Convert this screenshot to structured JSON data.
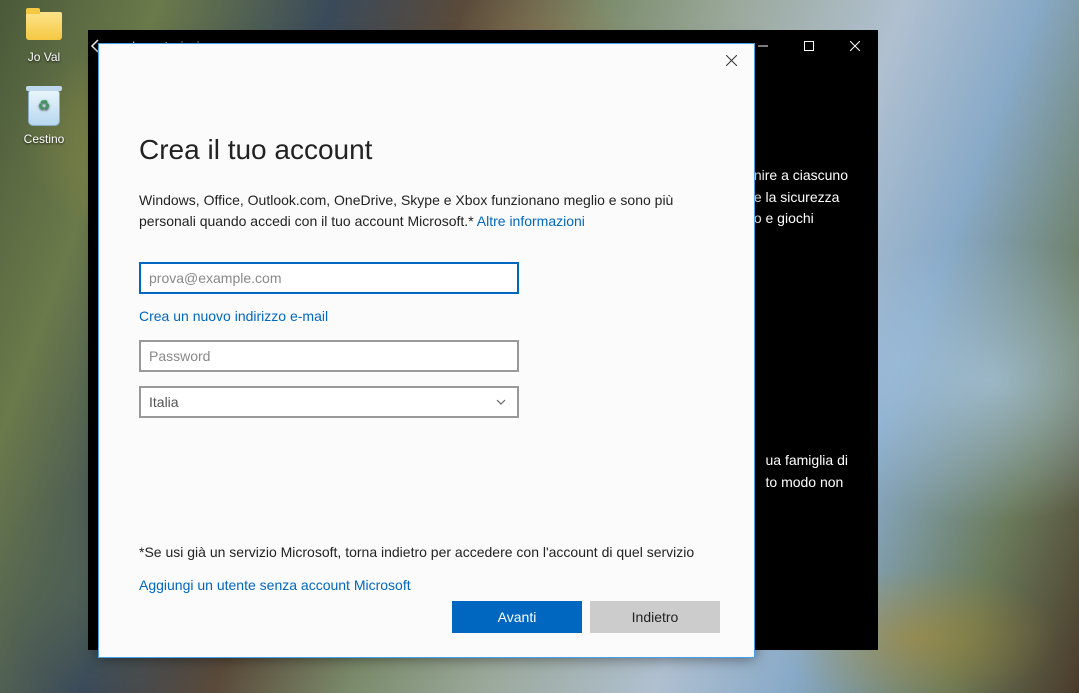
{
  "desktop": {
    "icons": [
      {
        "label": "Jo Val"
      },
      {
        "label": "Cestino"
      }
    ]
  },
  "settings_window": {
    "title": "Impostazioni",
    "partial_text_1": "nire a ciascuno\ne la sicurezza\no e giochi",
    "partial_text_2": "ua famiglia di\nto modo non"
  },
  "modal": {
    "title": "Crea il tuo account",
    "description": "Windows, Office, Outlook.com, OneDrive, Skype e Xbox funzionano meglio e sono più personali quando accedi con il tuo account Microsoft.*",
    "more_info_link": "Altre informazioni",
    "email_placeholder": "prova@example.com",
    "new_email_link": "Crea un nuovo indirizzo e-mail",
    "password_placeholder": "Password",
    "country_value": "Italia",
    "note": "*Se usi già un servizio Microsoft, torna indietro per accedere con l'account di quel servizio",
    "no_account_link": "Aggiungi un utente senza account Microsoft",
    "next_button": "Avanti",
    "back_button": "Indietro"
  }
}
